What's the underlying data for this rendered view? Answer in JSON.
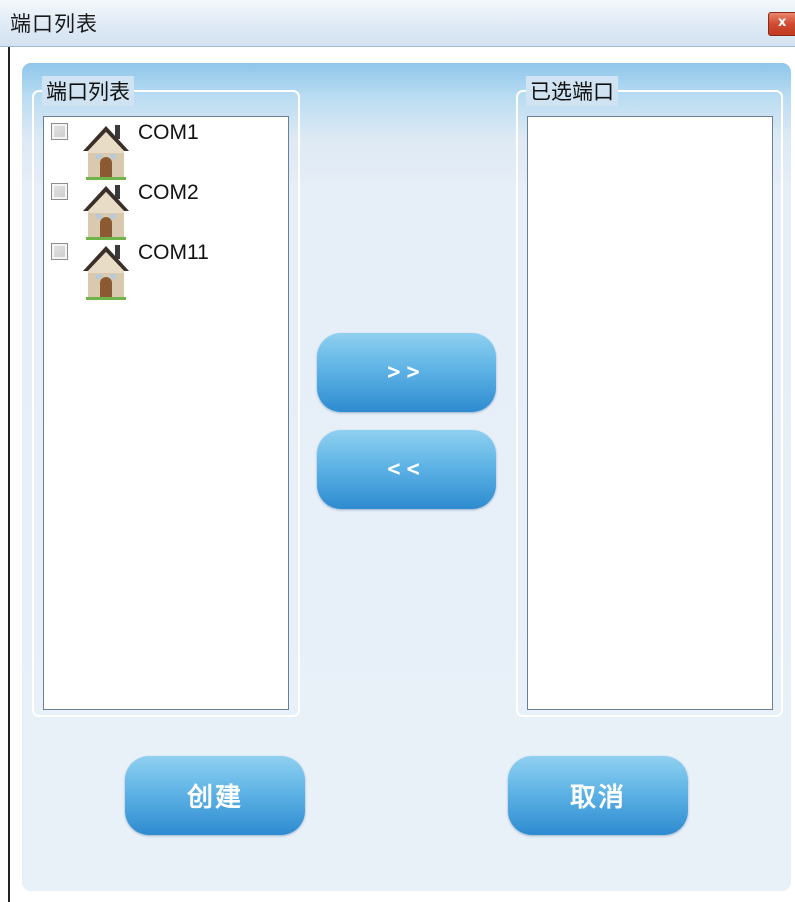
{
  "window": {
    "title": "端口列表",
    "close_label": "x"
  },
  "left_group": {
    "legend": "端口列表",
    "items": [
      {
        "label": "COM1",
        "checked": false,
        "icon": "house-icon"
      },
      {
        "label": "COM2",
        "checked": false,
        "icon": "house-icon"
      },
      {
        "label": "COM11",
        "checked": false,
        "icon": "house-icon"
      }
    ]
  },
  "right_group": {
    "legend": "已选端口",
    "items": []
  },
  "transfer": {
    "add_label": ">>",
    "remove_label": "<<"
  },
  "actions": {
    "create_label": "创建",
    "cancel_label": "取消"
  },
  "colors": {
    "accent": "#2e8bd0",
    "panel": "#e8f0f8",
    "close": "#cf4b30"
  }
}
